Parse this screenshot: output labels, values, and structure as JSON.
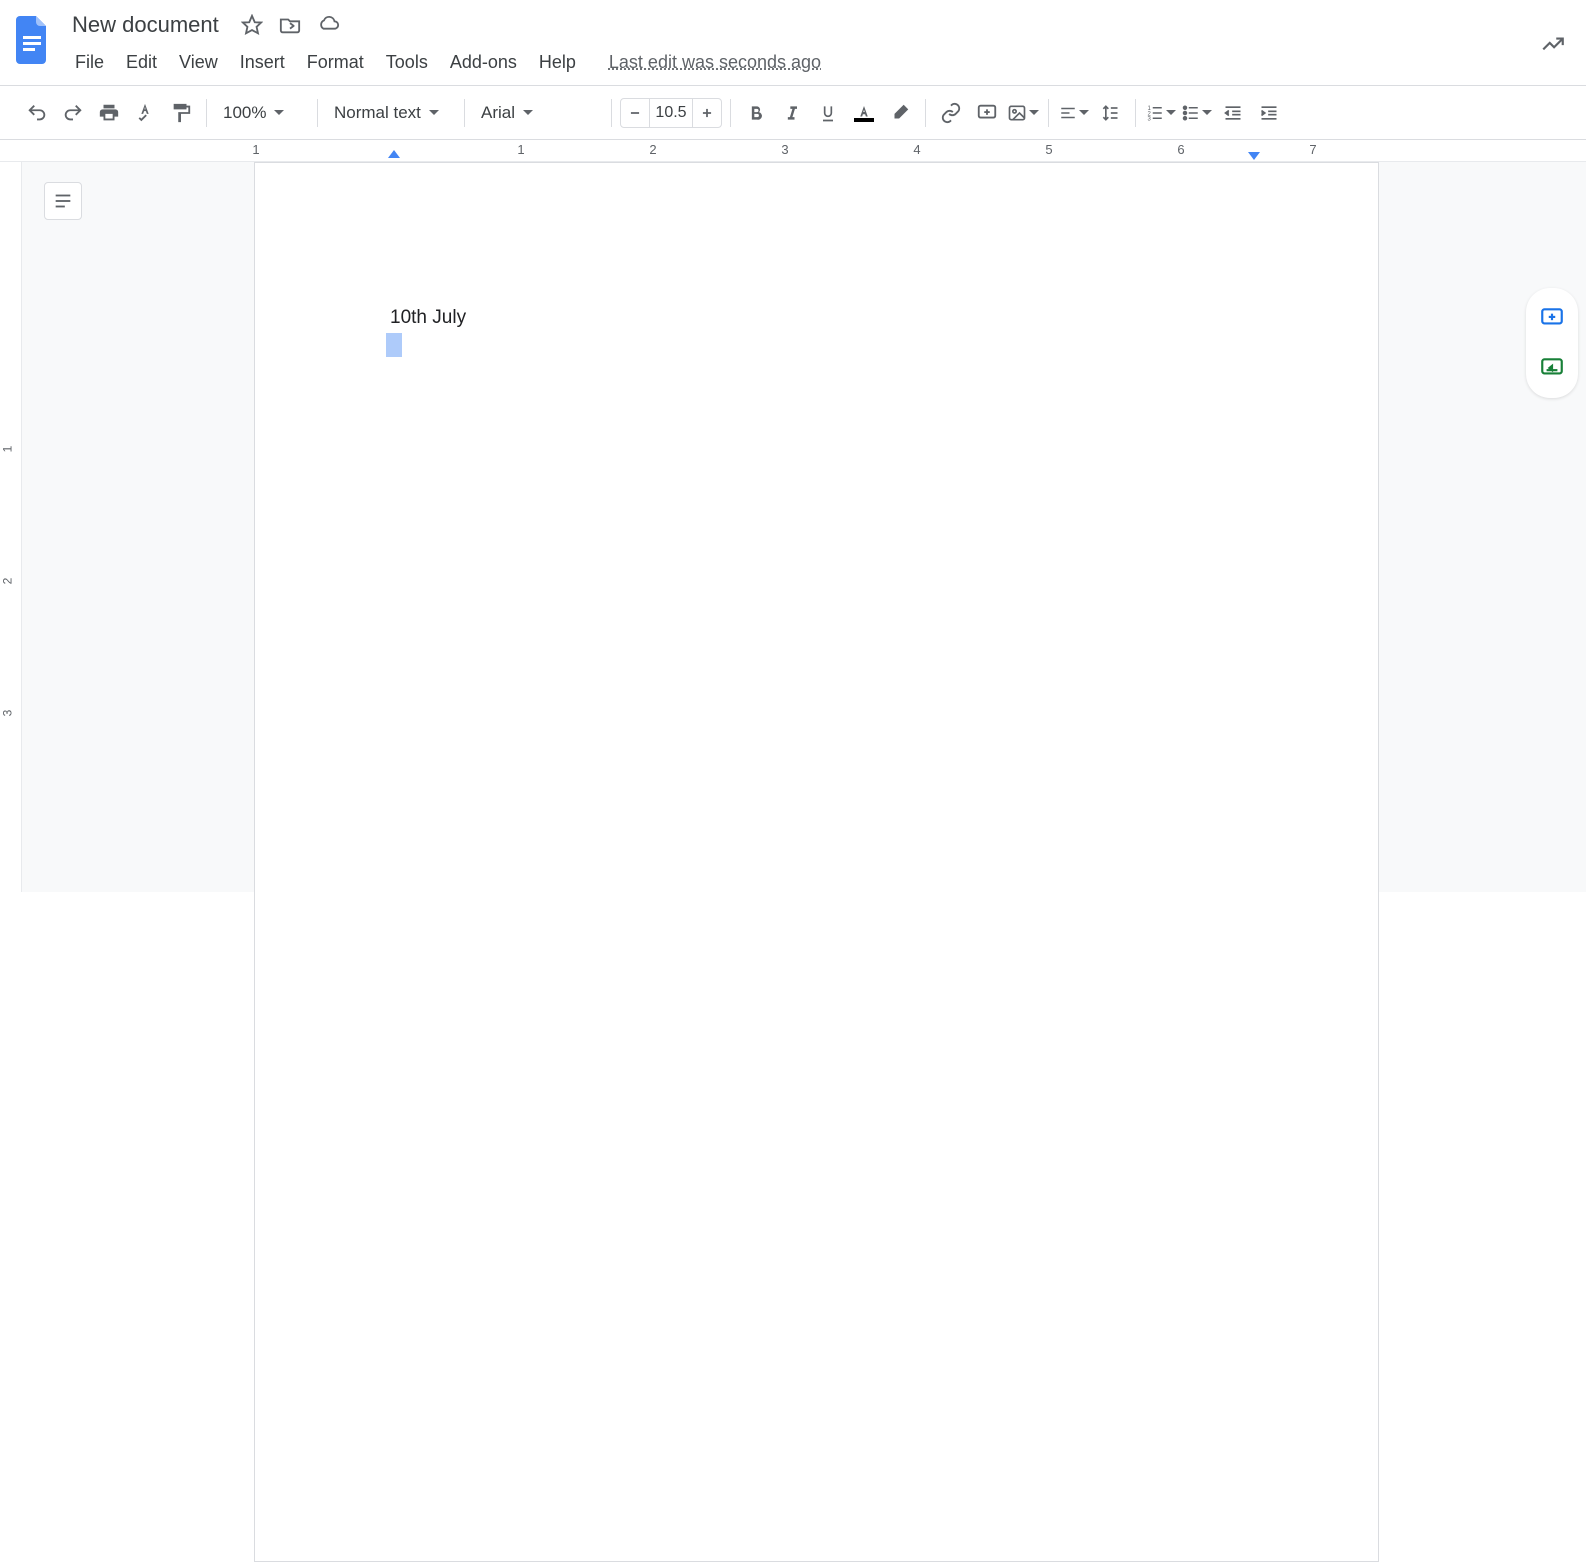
{
  "header": {
    "title": "New document",
    "menus": [
      "File",
      "Edit",
      "View",
      "Insert",
      "Format",
      "Tools",
      "Add-ons",
      "Help"
    ],
    "last_edit": "Last edit was seconds ago"
  },
  "toolbar": {
    "zoom": "100%",
    "style": "Normal text",
    "font": "Arial",
    "font_size": "10.5"
  },
  "ruler": {
    "h_numbers": [
      "1",
      "1",
      "2",
      "3",
      "4",
      "5",
      "6",
      "7"
    ],
    "v_numbers": [
      "1",
      "2",
      "3"
    ]
  },
  "document": {
    "line1_a": "10",
    "line1_b": "th",
    "line1_c": " July"
  }
}
